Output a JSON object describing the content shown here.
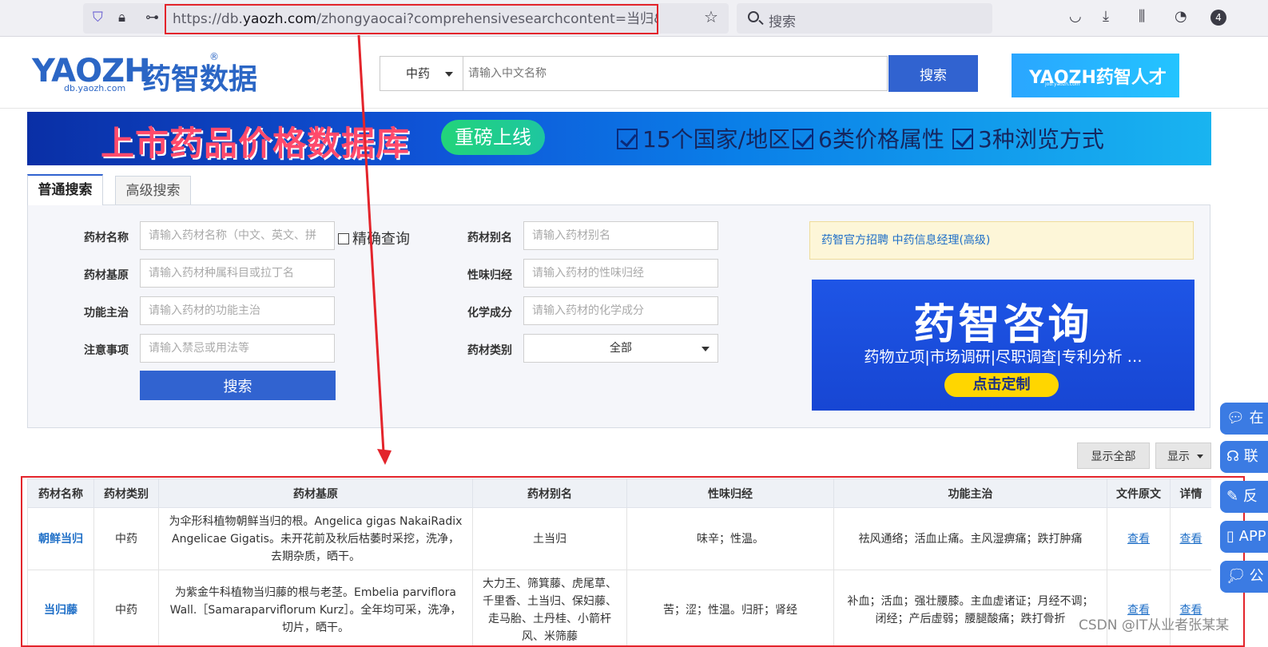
{
  "browser": {
    "url_prefix": "https://db.",
    "url_domain": "yaozh.com",
    "url_path": "/zhongyaocai?comprehensivesearchcontent=当归&",
    "search_label": "搜索",
    "badge_count": "4"
  },
  "header": {
    "logo_en": "YAOZH",
    "logo_zh": "药智数据",
    "logo_sub": "db.yaozh.com",
    "logo_reg": "®",
    "category": "中药",
    "search_placeholder": "请输入中文名称",
    "search_button": "搜索",
    "talent_title": "YAOZH药智人才",
    "talent_sub": "job.yaozh.com"
  },
  "banner": {
    "title": "上市药品价格数据库",
    "pill": "重磅上线",
    "features": [
      "15个国家/地区",
      "6类价格属性",
      "3种浏览方式"
    ]
  },
  "tabs": {
    "basic": "普通搜索",
    "advanced": "高级搜索"
  },
  "form": {
    "name_label": "药材名称",
    "name_placeholder": "请输入药材名称（中文、英文、拼",
    "exact_label": "精确查询",
    "alias_label": "药材别名",
    "alias_placeholder": "请输入药材别名",
    "origin_label": "药材基原",
    "origin_placeholder": "请输入药材种属科目或拉丁名",
    "taste_label": "性味归经",
    "taste_placeholder": "请输入药材的性味归经",
    "function_label": "功能主治",
    "function_placeholder": "请输入药材的功能主治",
    "chem_label": "化学成分",
    "chem_placeholder": "请输入药材的化学成分",
    "note_label": "注意事项",
    "note_placeholder": "请输入禁忌或用法等",
    "type_label": "药材类别",
    "type_value": "全部",
    "search_button": "搜索"
  },
  "notice": {
    "text": "药智官方招聘 中药信息经理(高级)"
  },
  "ad": {
    "title": "药智咨询",
    "subtitle": "药物立项|市场调研|尽职调查|专利分析 …",
    "cta": "点击定制"
  },
  "controls": {
    "show_all": "显示全部",
    "show": "显示"
  },
  "table": {
    "headers": [
      "药材名称",
      "药材类别",
      "药材基原",
      "药材别名",
      "性味归经",
      "功能主治",
      "文件原文",
      "详情"
    ],
    "rows": [
      {
        "name": "朝鲜当归",
        "type": "中药",
        "origin": "为伞形科植物朝鲜当归的根。Angelica gigas NakaiRadix Angelicae Gigatis。未开花前及秋后枯萎时采挖，洗净，去期杂质，晒干。",
        "alias": "土当归",
        "taste": "味辛；性温。",
        "function": "祛风通络；活血止痛。主风湿痹痛；跌打肿痛",
        "doc": "查看",
        "detail": "查看"
      },
      {
        "name": "当归藤",
        "type": "中药",
        "origin": "为紫金牛科植物当归藤的根与老茎。Embelia parviflora Wall.［Samaraparviflorum Kurz］。全年均可采，洗净，切片，晒干。",
        "alias": "大力王、筛箕藤、虎尾草、千里香、土当归、保妇藤、走马胎、土丹桂、小箭杆风、米筛藤",
        "taste": "苦；涩；性温。归肝；肾经",
        "function": "补血；活血；强壮腰膝。主血虚诸证；月经不调；闭经；产后虚弱；腰腿酸痛；跌打骨折",
        "doc": "查看",
        "detail": "查看"
      }
    ]
  },
  "side_tools": [
    "在",
    "联",
    "反",
    "APP",
    "公"
  ],
  "watermark": "CSDN @IT从业者张某某",
  "colors": {
    "primary": "#3163d0",
    "link": "#1f6fc7",
    "annotation_red": "#e3242b"
  }
}
